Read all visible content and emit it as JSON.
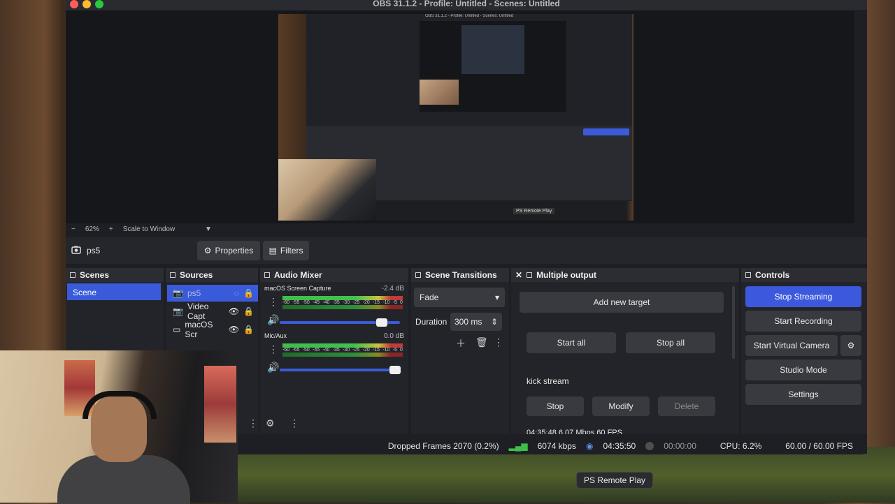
{
  "window": {
    "title": "OBS 31.1.2 - Profile: Untitled - Scenes: Untitled"
  },
  "preview": {
    "nested_title": "OBS 31.1.2 - Profile: Untitled - Scenes: Untitled",
    "nested_label": "PS Remote Play"
  },
  "zoom": {
    "minus": "−",
    "value": "62%",
    "plus": "+",
    "mode": "Scale to Window"
  },
  "source_toolbar": {
    "source_name": "ps5",
    "properties_label": "Properties",
    "filters_label": "Filters"
  },
  "scenes": {
    "header": "Scenes",
    "items": [
      "Scene"
    ]
  },
  "sources": {
    "header": "Sources",
    "items": [
      {
        "name": "ps5",
        "visible": false
      },
      {
        "name": "Video Capt",
        "visible": true
      },
      {
        "name": "macOS Scr",
        "visible": true
      }
    ]
  },
  "mixer": {
    "header": "Audio Mixer",
    "channels": [
      {
        "name": "macOS Screen Capture",
        "db": "-2.4 dB",
        "level": 0.86
      },
      {
        "name": "Mic/Aux",
        "db": "0.0 dB",
        "level": 0.97
      }
    ],
    "scale": [
      "-60",
      "-55",
      "-50",
      "-45",
      "-40",
      "-35",
      "-30",
      "-25",
      "-20",
      "-15",
      "-10",
      "-5",
      "0"
    ]
  },
  "transitions": {
    "header": "Scene Transitions",
    "type": "Fade",
    "duration_label": "Duration",
    "duration": "300 ms"
  },
  "multi_output": {
    "header": "Multiple output",
    "add_target": "Add new target",
    "start_all": "Start all",
    "stop_all": "Stop all",
    "target_name": "kick stream",
    "stop": "Stop",
    "modify": "Modify",
    "delete": "Delete",
    "stats": "04:35:48  6.07 Mbps  60 FPS"
  },
  "controls": {
    "header": "Controls",
    "stop_streaming": "Stop Streaming",
    "start_recording": "Start Recording",
    "start_virtual_camera": "Start Virtual Camera",
    "studio_mode": "Studio Mode",
    "settings": "Settings"
  },
  "status": {
    "dropped": "Dropped Frames 2070 (0.2%)",
    "bitrate": "6074 kbps",
    "stream_time": "04:35:50",
    "rec_time": "00:00:00",
    "cpu": "CPU: 6.2%",
    "fps": "60.00 / 60.00 FPS"
  },
  "tooltip": {
    "label": "PS Remote Play"
  },
  "colors": {
    "accent": "#3c59dd",
    "panel": "#232429",
    "window": "#1e1f24"
  }
}
